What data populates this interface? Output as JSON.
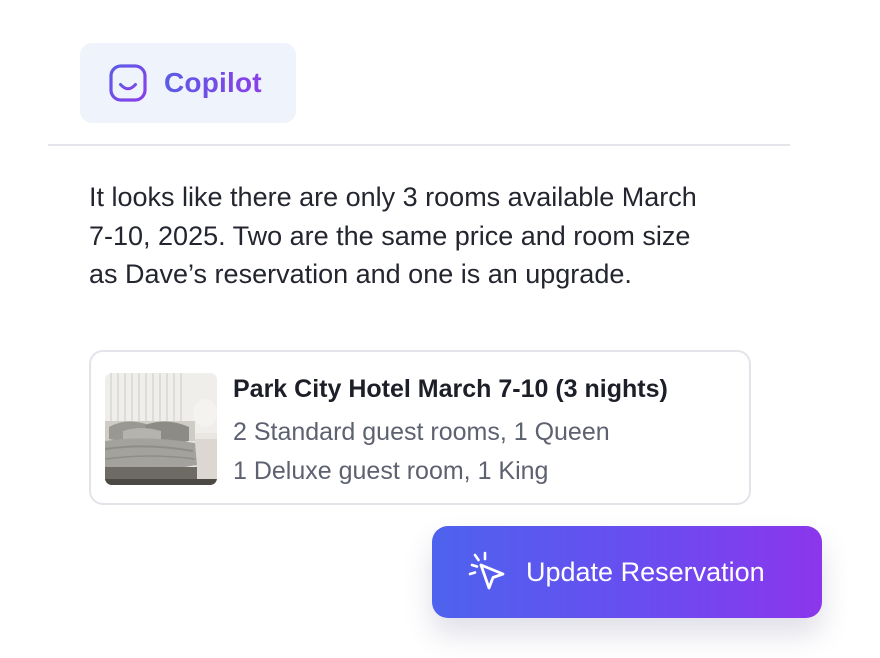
{
  "header": {
    "brand_label": "Copilot",
    "brand_icon": "smiley-logo-icon",
    "badge_background": "#eef3fc",
    "brand_gradient": [
      "#5b5ce6",
      "#8a3fe8"
    ]
  },
  "message": {
    "text": "It looks like there are only 3 rooms available March 7-10, 2025. Two are the same price and room size as Dave’s reservation and one is an upgrade."
  },
  "result_card": {
    "image": "hotel-room-thumbnail",
    "title": "Park City Hotel March 7-10 (3 nights)",
    "lines": [
      "2 Standard guest rooms, 1 Queen",
      "1 Deluxe guest room, 1 King"
    ]
  },
  "action": {
    "label": "Update Reservation",
    "icon": "cursor-click-icon",
    "gradient": [
      "#4d63ee",
      "#8c36ec"
    ]
  }
}
